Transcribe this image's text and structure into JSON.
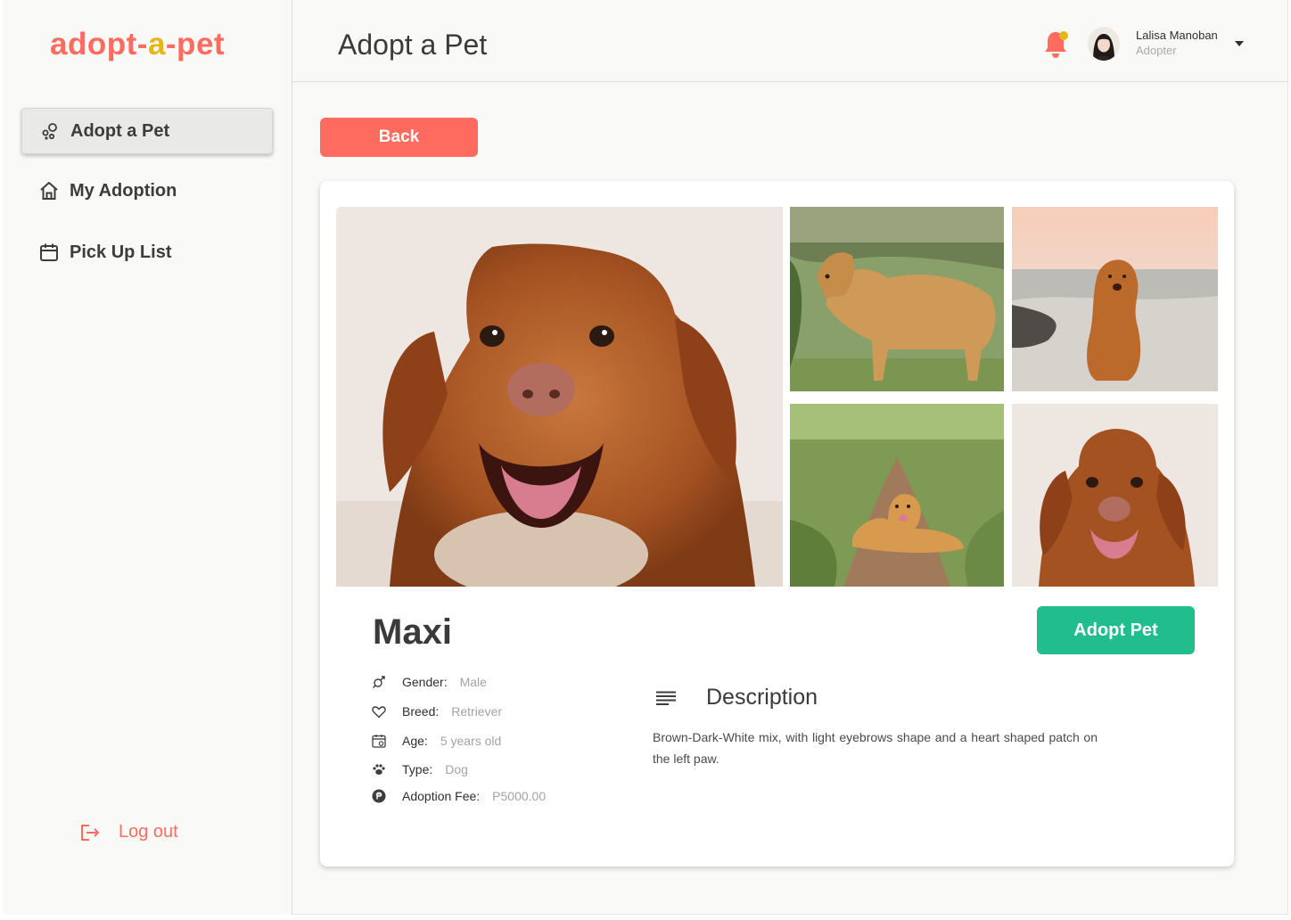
{
  "app": {
    "logo_part1": "ado",
    "logo_paw": "o",
    "logo_part2": "pt-",
    "logo_part3": "a",
    "logo_part4": "-pet",
    "brand_color": "#ff6b5e",
    "accent_color": "#e6b51a"
  },
  "sidebar": {
    "items": [
      {
        "label": "Adopt a Pet",
        "icon": "adopt-icon",
        "active": true
      },
      {
        "label": "My Adoption",
        "icon": "home-icon",
        "active": false
      },
      {
        "label": "Pick Up List",
        "icon": "calendar-icon",
        "active": false
      }
    ],
    "logout_label": "Log out"
  },
  "header": {
    "title": "Adopt a Pet",
    "user": {
      "name": "Lalisa Manoban",
      "role": "Adopter"
    }
  },
  "actions": {
    "back_label": "Back",
    "adopt_label": "Adopt Pet",
    "back_color": "#ff6b5e",
    "adopt_color": "#22bd8c"
  },
  "pet": {
    "name": "Maxi",
    "attributes": [
      {
        "label": "Gender:",
        "value": "Male",
        "icon": "gender-icon"
      },
      {
        "label": "Breed:",
        "value": "Retriever",
        "icon": "heart-icon"
      },
      {
        "label": "Age:",
        "value": "5 years old",
        "icon": "calendar-icon"
      },
      {
        "label": "Type:",
        "value": "Dog",
        "icon": "paw-icon"
      },
      {
        "label": "Adoption Fee:",
        "value": "P5000.00",
        "icon": "peso-icon"
      }
    ],
    "description_title": "Description",
    "description": "Brown-Dark-White mix, with light eyebrows shape and a heart shaped patch on the left paw."
  }
}
